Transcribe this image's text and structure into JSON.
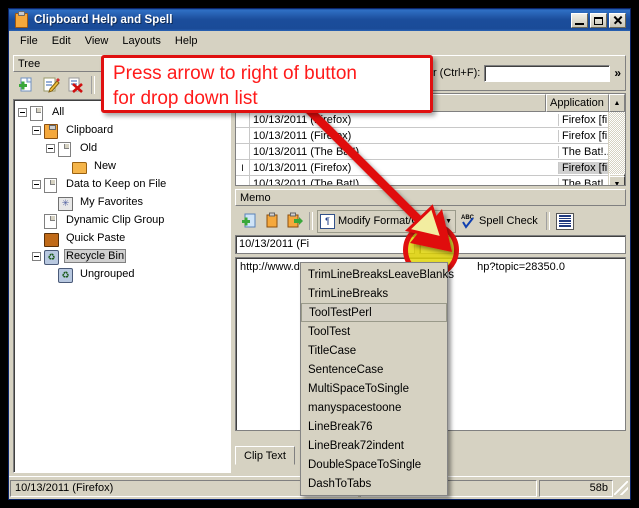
{
  "window": {
    "title": "Clipboard Help and Spell",
    "icon": "clipboard-icon",
    "minimize_label": "_",
    "maximize_label": "□",
    "close_label": "✕"
  },
  "menubar": {
    "items": [
      "File",
      "Edit",
      "View",
      "Layouts",
      "Help"
    ]
  },
  "left_pane": {
    "header": "Tree",
    "toolbar": [
      {
        "name": "new-clip-icon",
        "glyph": "+"
      },
      {
        "name": "edit-clip-icon",
        "glyph": "✎"
      },
      {
        "name": "delete-clip-icon",
        "glyph": "✖"
      },
      {
        "name": "add-group-icon",
        "glyph": "+"
      },
      {
        "name": "add-subgroup-icon",
        "glyph": "+"
      }
    ],
    "tree": [
      {
        "label": "All",
        "depth": 0,
        "expander": "minus",
        "icon": "document-icon",
        "selected": false
      },
      {
        "label": "Clipboard",
        "depth": 1,
        "expander": "minus",
        "icon": "clipboard-icon",
        "selected": false
      },
      {
        "label": "Old",
        "depth": 2,
        "expander": "minus",
        "icon": "document-icon",
        "selected": false
      },
      {
        "label": "New",
        "depth": 3,
        "expander": "none",
        "icon": "folder-icon",
        "selected": false
      },
      {
        "label": "Data to Keep on File",
        "depth": 1,
        "expander": "minus",
        "icon": "document-icon",
        "selected": false
      },
      {
        "label": "My Favorites",
        "depth": 2,
        "expander": "none",
        "icon": "favorites-icon",
        "selected": false
      },
      {
        "label": "Dynamic Clip Group",
        "depth": 1,
        "expander": "none",
        "icon": "document-icon",
        "selected": false
      },
      {
        "label": "Quick Paste",
        "depth": 1,
        "expander": "none",
        "icon": "quick-paste-icon",
        "selected": false
      },
      {
        "label": "Recycle Bin",
        "depth": 1,
        "expander": "minus",
        "icon": "recycle-bin-icon",
        "selected": true
      },
      {
        "label": "Ungrouped",
        "depth": 2,
        "expander": "none",
        "icon": "recycle-bin-icon",
        "selected": false
      }
    ]
  },
  "find_bar": {
    "label": "er (Ctrl+F):",
    "value": "",
    "expand_glyph": "»"
  },
  "list_view": {
    "columns": [
      "",
      "Application"
    ],
    "rows": [
      {
        "marker": "",
        "clip": "10/13/2011 (Firefox)",
        "application": "Firefox [fi...",
        "selected": false
      },
      {
        "marker": "",
        "clip": "10/13/2011 (Firefox)",
        "application": "Firefox [fi...",
        "selected": false
      },
      {
        "marker": "",
        "clip": "10/13/2011 (The Bat!)",
        "application": "The Bat!...",
        "selected": false
      },
      {
        "marker": "I",
        "clip": "10/13/2011 (Firefox)",
        "application": "Firefox [fi...",
        "selected": true
      },
      {
        "marker": "",
        "clip": "10/13/2011 (The Bat!)",
        "application": "The Bat!...",
        "selected": false
      }
    ],
    "scroll_up": "▲",
    "scroll_down": "▼"
  },
  "memo": {
    "header": "Memo",
    "toolbar": [
      {
        "name": "new-memo-icon",
        "glyph": "+"
      },
      {
        "name": "copy-clipboard-icon",
        "glyph": ""
      },
      {
        "name": "paste-out-icon",
        "glyph": "→"
      }
    ],
    "format_button": {
      "label": "Modify Format/Case",
      "icon": "format-paragraph-icon",
      "arrow": "▼"
    },
    "spell_check": {
      "label": "Spell Check",
      "icon": "abc-check-icon",
      "badge": "ABC"
    },
    "wrap_button": {
      "name": "word-wrap-icon"
    },
    "title_value": "10/13/2011 (Fi",
    "second_value": "",
    "body_left": "http://www.do",
    "body_right": "hp?topic=28350.0",
    "tab_label": "Clip Text"
  },
  "callout": {
    "line1": "Press arrow to right of button",
    "line2": "for drop down list",
    "border_color": "#e01010",
    "text_color": "#ff1a1a",
    "highlight_fill": "#e2d608"
  },
  "dropdown": {
    "items": [
      {
        "label": "TrimLineBreaksLeaveBlanks",
        "highlighted": false
      },
      {
        "label": "TrimLineBreaks",
        "highlighted": false
      },
      {
        "label": "ToolTestPerl",
        "highlighted": true
      },
      {
        "label": "ToolTest",
        "highlighted": false
      },
      {
        "label": "TitleCase",
        "highlighted": false
      },
      {
        "label": "SentenceCase",
        "highlighted": false
      },
      {
        "label": "MultiSpaceToSingle",
        "highlighted": false
      },
      {
        "label": "manyspacestoone",
        "highlighted": false
      },
      {
        "label": "LineBreak76",
        "highlighted": false
      },
      {
        "label": "LineBreak72indent",
        "highlighted": false
      },
      {
        "label": "DoubleSpaceToSingle",
        "highlighted": false
      },
      {
        "label": "DashToTabs",
        "highlighted": false
      }
    ]
  },
  "statusbar": {
    "left": "10/13/2011 (Firefox)",
    "middle": "",
    "right": "58b"
  }
}
